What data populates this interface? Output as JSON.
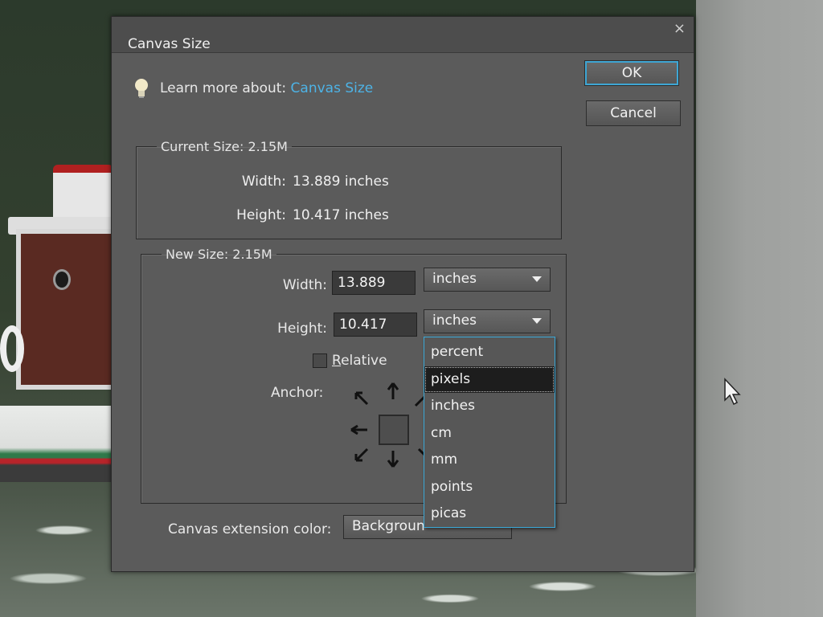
{
  "dialog": {
    "title": "Canvas Size",
    "close_glyph": "×",
    "learn_more_prefix": "Learn more about:",
    "learn_more_link": "Canvas Size",
    "ok_label": "OK",
    "cancel_label": "Cancel"
  },
  "current_size": {
    "legend": "Current Size: 2.15M",
    "width_label": "Width:",
    "width_value": "13.889 inches",
    "height_label": "Height:",
    "height_value": "10.417 inches"
  },
  "new_size": {
    "legend": "New Size: 2.15M",
    "width_label": "Width:",
    "width_value": "13.889",
    "width_unit": "inches",
    "height_label": "Height:",
    "height_value": "10.417",
    "height_unit": "inches",
    "relative_label_underlined": "R",
    "relative_label_rest": "elative",
    "relative_checked": false,
    "anchor_label": "Anchor:"
  },
  "extension": {
    "label": "Canvas extension color:",
    "value": "Backgroun"
  },
  "unit_dropdown": {
    "open": true,
    "options": [
      "percent",
      "pixels",
      "inches",
      "cm",
      "mm",
      "points",
      "picas"
    ],
    "highlighted": "pixels"
  },
  "colors": {
    "accent": "#3ba9d8",
    "link": "#4db3e6",
    "dialog_bg": "#5b5b5b"
  },
  "icons": {
    "lightbulb": "lightbulb-icon",
    "close": "close-icon",
    "dropdown": "chevron-down-icon",
    "cursor": "mouse-pointer-icon"
  }
}
